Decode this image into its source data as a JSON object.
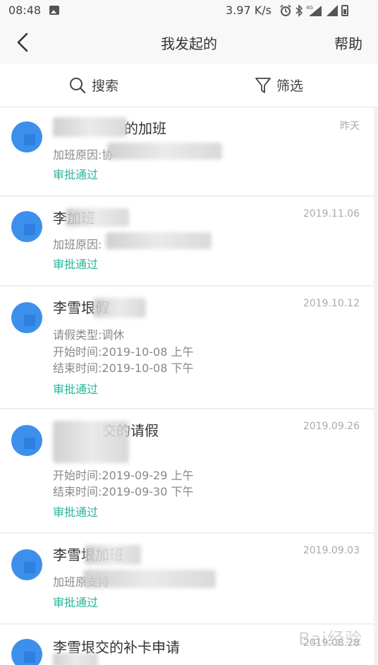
{
  "status_bar": {
    "time": "08:48",
    "speed": "3.97 K/s",
    "net": "4G"
  },
  "nav": {
    "title": "我发起的",
    "help": "帮助"
  },
  "filters": {
    "search": "搜索",
    "screen": "筛选"
  },
  "colors": {
    "accent_green": "#27b39a",
    "avatar_blue": "#3d8fec"
  },
  "items": [
    {
      "title": "的加班",
      "date": "昨天",
      "line1": "加班原因:协",
      "status": "审批通过"
    },
    {
      "title": "李加班",
      "date": "2019.11.06",
      "line1": "加班原因:",
      "status": "审批通过"
    },
    {
      "title": "李雪垠假",
      "date": "2019.10.12",
      "line1": "请假类型:调休",
      "line2": "开始时间:2019-10-08 上午",
      "line3": "结束时间:2019-10-08 下午",
      "status": "审批通过"
    },
    {
      "title": "交的请假",
      "date": "2019.09.26",
      "line2": "开始时间:2019-09-29 上午",
      "line3": "结束时间:2019-09-30 下午",
      "status": "审批通过"
    },
    {
      "title": "李雪垠加班",
      "date": "2019.09.03",
      "line1": "加班原支持",
      "status": "审批通过"
    },
    {
      "title": "李雪垠交的补卡申请",
      "date": "2019.08.28"
    }
  ],
  "watermark": "Bai经验"
}
